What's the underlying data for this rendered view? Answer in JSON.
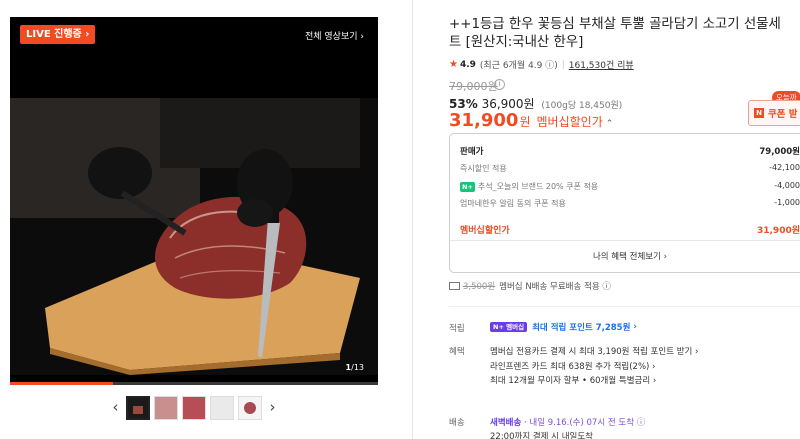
{
  "gallery": {
    "live_label": "LIVE 진행중",
    "watch_all": "전체 영상보기",
    "counter_current": "1",
    "counter_total": "/13",
    "progress": 0.28,
    "thumbnails": [
      "thumb-1",
      "thumb-2",
      "thumb-3",
      "thumb-4",
      "thumb-5"
    ]
  },
  "product": {
    "title": "++1등급 한우 꽃등심 부채살 투뿔 골라담기 소고기 선물세트 [원산지:국내산 한우]",
    "rating": "4.9",
    "rating_recent": "(최근 6개월 4.9",
    "review_count": "161,530건 리뷰",
    "original_price": "79,000원",
    "discount_pct": "53%",
    "discount_price": "36,900원",
    "unit_price": "(100g당 18,450원)",
    "member_price": "31,900",
    "member_won": "원",
    "member_label": "멤버십할인가",
    "today_tag": "오늘까",
    "coupon_label": "쿠폰 받"
  },
  "breakdown": {
    "rows": [
      {
        "label": "판매가",
        "value": "79,000원"
      },
      {
        "label": "즉시할인 적용",
        "value": "-42,100"
      },
      {
        "badge": "N+",
        "label": "추석_오늘의 브랜드 20% 쿠폰 적용",
        "value": "-4,000"
      },
      {
        "label": "엄마네한우 알림 동의 쿠폰 적용",
        "value": "-1,000"
      }
    ],
    "total_label": "멤버십할인가",
    "total_value": "31,900원",
    "all_benefits": "나의 혜택 전체보기"
  },
  "shipping": {
    "old_fee": "3,500원",
    "text": "멤버십 N배송 무료배송 적용"
  },
  "points": {
    "label": "적립",
    "badge": "N+ 멤버십",
    "text": "최대 적립 포인트 7,285원"
  },
  "benefits": {
    "label": "혜택",
    "lines": [
      "멤버십 전용카드 결제 시 최대 3,190원 적립 포인트 받기",
      "라인프렌즈 카드 최대 638원 추가 적립(2%)",
      "최대 12개월 무이자 할부 • 60개월 특별금리"
    ]
  },
  "delivery": {
    "label": "배송",
    "type": "새벽배송",
    "eta": "내일 9.16.(수) 07시 전 도착",
    "cutoff": "22:00까지 결제 시 내일도착"
  }
}
